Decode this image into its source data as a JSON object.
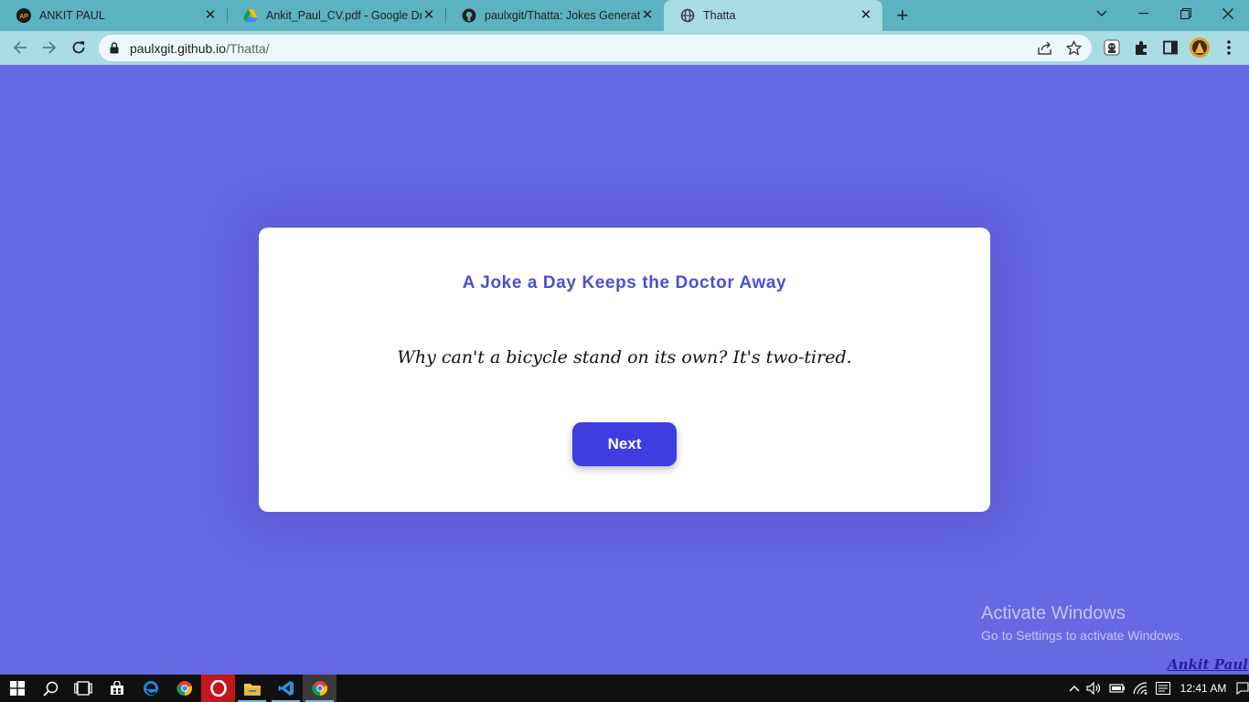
{
  "browser": {
    "tabs": [
      {
        "title": "ANKIT PAUL",
        "favicon": "ap-logo-icon"
      },
      {
        "title": "Ankit_Paul_CV.pdf - Google Drive",
        "favicon": "google-drive-icon"
      },
      {
        "title": "paulxgit/Thatta: Jokes Generator",
        "favicon": "github-icon"
      },
      {
        "title": "Thatta",
        "favicon": "globe-icon",
        "active": true
      }
    ],
    "address": {
      "host": "paulxgit.github.io",
      "path": "/Thatta/"
    }
  },
  "page": {
    "headline": "A Joke a Day Keeps the Doctor Away",
    "joke": "Why can't a bicycle stand on its own? It's two-tired.",
    "next_label": "Next",
    "watermark_title": "Activate Windows",
    "watermark_subtitle": "Go to Settings to activate Windows.",
    "credit": "Ankit Paul"
  },
  "taskbar": {
    "apps": [
      "start-icon",
      "search-icon",
      "task-view-icon",
      "store-icon",
      "edge-icon",
      "chrome-icon",
      "opera-icon",
      "file-explorer-icon",
      "vscode-icon",
      "chrome-active-icon"
    ],
    "clock": "12:41 AM"
  },
  "colors": {
    "page_bg": "#6769e2",
    "accent": "#3f3ddf",
    "headline": "#4b4fd6",
    "tabstrip": "#5bb2c1",
    "toolbar": "#a8dbe2"
  }
}
